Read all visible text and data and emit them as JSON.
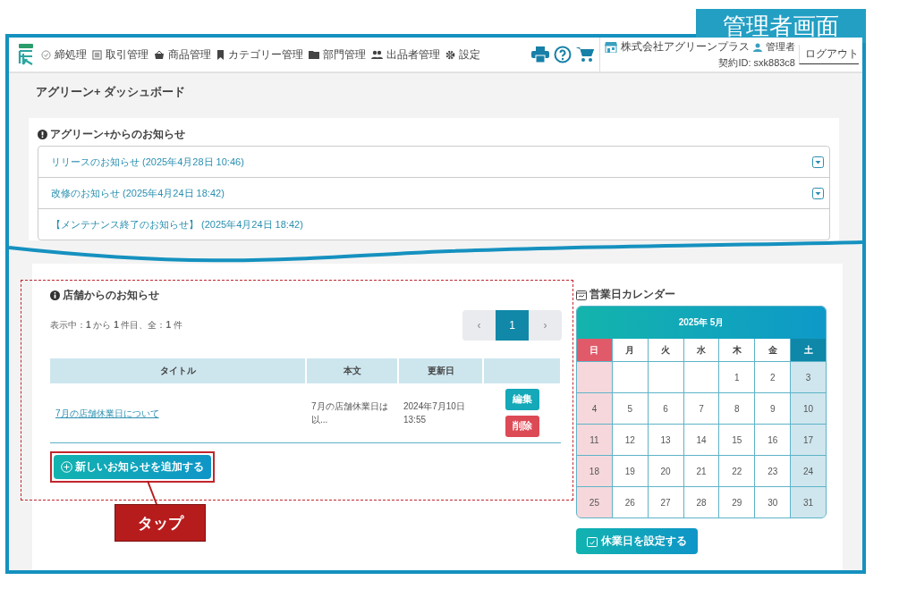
{
  "annotation_label": "管理者画面",
  "header": {
    "nav": [
      {
        "label": "締処理"
      },
      {
        "label": "取引管理"
      },
      {
        "label": "商品管理"
      },
      {
        "label": "カテゴリー管理"
      },
      {
        "label": "部門管理"
      },
      {
        "label": "出品者管理"
      },
      {
        "label": "設定"
      }
    ],
    "company": "株式会社アグリーンプラス",
    "user": "管理者",
    "contract_id": "契約ID: sxk883c8",
    "logout": "ログアウト"
  },
  "page_title": "アグリーン+ ダッシュボード",
  "agreen_notices": {
    "title": "アグリーン+からのお知らせ",
    "items": [
      {
        "label": "リリースのお知らせ (2025年4月28日 10:46)",
        "expandable": true
      },
      {
        "label": "改修のお知らせ (2025年4月24日 18:42)",
        "expandable": true
      },
      {
        "label": "【メンテナンス終了のお知らせ】 (2025年4月24日 18:42)",
        "expandable": false
      }
    ]
  },
  "store_notices": {
    "title": "店舗からのお知らせ",
    "summary": "表示中：**1** から **1** 件目、全：**1** 件",
    "pagination": {
      "prev": "‹",
      "pages": [
        {
          "label": "1",
          "selected": true
        }
      ],
      "next": "›"
    },
    "table": {
      "columns": [
        "タイトル",
        "本文",
        "更新日"
      ],
      "rows": [
        {
          "title": "7月の店舗休業日について",
          "body": "7月の店舗休業日は以...",
          "updated": "2024年7月10日 13:55",
          "actions": [
            {
              "label": "編集",
              "kind": "edit"
            },
            {
              "label": "削除",
              "kind": "delete"
            }
          ]
        }
      ]
    },
    "add_button": "新しいお知らせを追加する",
    "callout": "タップ"
  },
  "calendar": {
    "title": "営業日カレンダー",
    "month": "2025年 5月",
    "weekdays": [
      {
        "label": "日",
        "kind": "sunday"
      },
      {
        "label": "月",
        "kind": "weekday"
      },
      {
        "label": "火",
        "kind": "weekday"
      },
      {
        "label": "水",
        "kind": "weekday"
      },
      {
        "label": "木",
        "kind": "weekday"
      },
      {
        "label": "金",
        "kind": "weekday"
      },
      {
        "label": "土",
        "kind": "saturday"
      }
    ],
    "weeks": [
      [
        {
          "kind": "blank"
        },
        {
          "kind": "blank"
        },
        {
          "kind": "blank"
        },
        {
          "kind": "blank"
        },
        {
          "kind": "date",
          "label": "1"
        },
        {
          "kind": "date",
          "label": "2"
        },
        {
          "kind": "date",
          "label": "3"
        }
      ],
      [
        {
          "kind": "date",
          "label": "4"
        },
        {
          "kind": "date",
          "label": "5"
        },
        {
          "kind": "date",
          "label": "6"
        },
        {
          "kind": "date",
          "label": "7"
        },
        {
          "kind": "date",
          "label": "8"
        },
        {
          "kind": "date",
          "label": "9"
        },
        {
          "kind": "date",
          "label": "10"
        }
      ],
      [
        {
          "kind": "date",
          "label": "11"
        },
        {
          "kind": "date",
          "label": "12"
        },
        {
          "kind": "date",
          "label": "13"
        },
        {
          "kind": "date",
          "label": "14"
        },
        {
          "kind": "date",
          "label": "15"
        },
        {
          "kind": "date",
          "label": "16"
        },
        {
          "kind": "date",
          "label": "17"
        }
      ],
      [
        {
          "kind": "date",
          "label": "18"
        },
        {
          "kind": "date",
          "label": "19"
        },
        {
          "kind": "date",
          "label": "20"
        },
        {
          "kind": "date",
          "label": "21"
        },
        {
          "kind": "date",
          "label": "22"
        },
        {
          "kind": "date",
          "label": "23"
        },
        {
          "kind": "date",
          "label": "24"
        }
      ],
      [
        {
          "kind": "date",
          "label": "25"
        },
        {
          "kind": "date",
          "label": "26"
        },
        {
          "kind": "date",
          "label": "27"
        },
        {
          "kind": "date",
          "label": "28"
        },
        {
          "kind": "date",
          "label": "29"
        },
        {
          "kind": "date",
          "label": "30"
        },
        {
          "kind": "date",
          "label": "31"
        }
      ]
    ],
    "button": "休業日を設定する"
  }
}
